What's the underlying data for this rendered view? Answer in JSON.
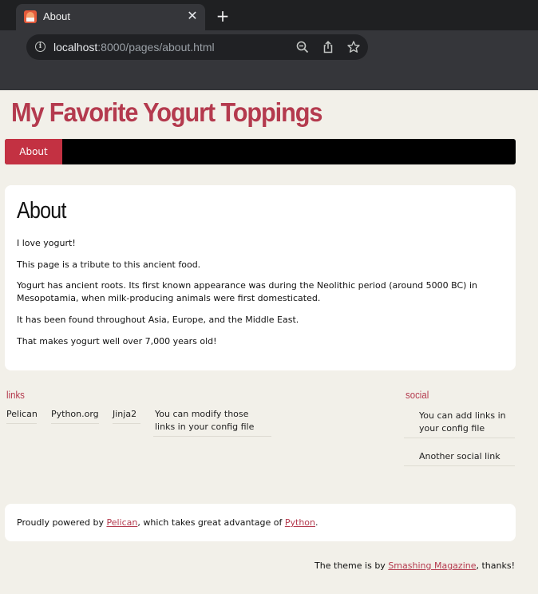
{
  "browser": {
    "tab_title": "About",
    "close_glyph": "✕",
    "new_tab_glyph": "+",
    "url_host": "localhost",
    "url_rest": ":8000/pages/about.html",
    "info_glyph": "i"
  },
  "site": {
    "title": "My Favorite Yogurt Toppings",
    "nav": [
      {
        "label": "About"
      }
    ]
  },
  "article": {
    "title": "About",
    "paragraphs": [
      "I love yogurt!",
      "This page is a tribute to this ancient food.",
      "Yogurt has ancient roots. Its first known appearance was during the Neolithic period (around 5000 BC) in Mesopotamia, when milk-producing animals were first domesticated.",
      "It has been found throughout Asia, Europe, and the Middle East.",
      "That makes yogurt well over 7,000 years old!"
    ]
  },
  "links": {
    "title": "links",
    "items": [
      "Pelican",
      "Python.org",
      "Jinja2",
      "You can modify those links in your config file"
    ]
  },
  "social": {
    "title": "social",
    "items": [
      "You can add links in your config file",
      "Another social link"
    ]
  },
  "footer": {
    "powered_prefix": "Proudly powered by ",
    "powered_link1": "Pelican",
    "powered_middle": ", which takes great advantage of ",
    "powered_link2": "Python",
    "powered_suffix": ".",
    "theme_prefix": "The theme is by ",
    "theme_link": "Smashing Magazine",
    "theme_suffix": ", thanks!"
  },
  "colors": {
    "accent": "#b43a4e",
    "nav_active": "#c33142",
    "page_bg": "#f2f0e9"
  }
}
